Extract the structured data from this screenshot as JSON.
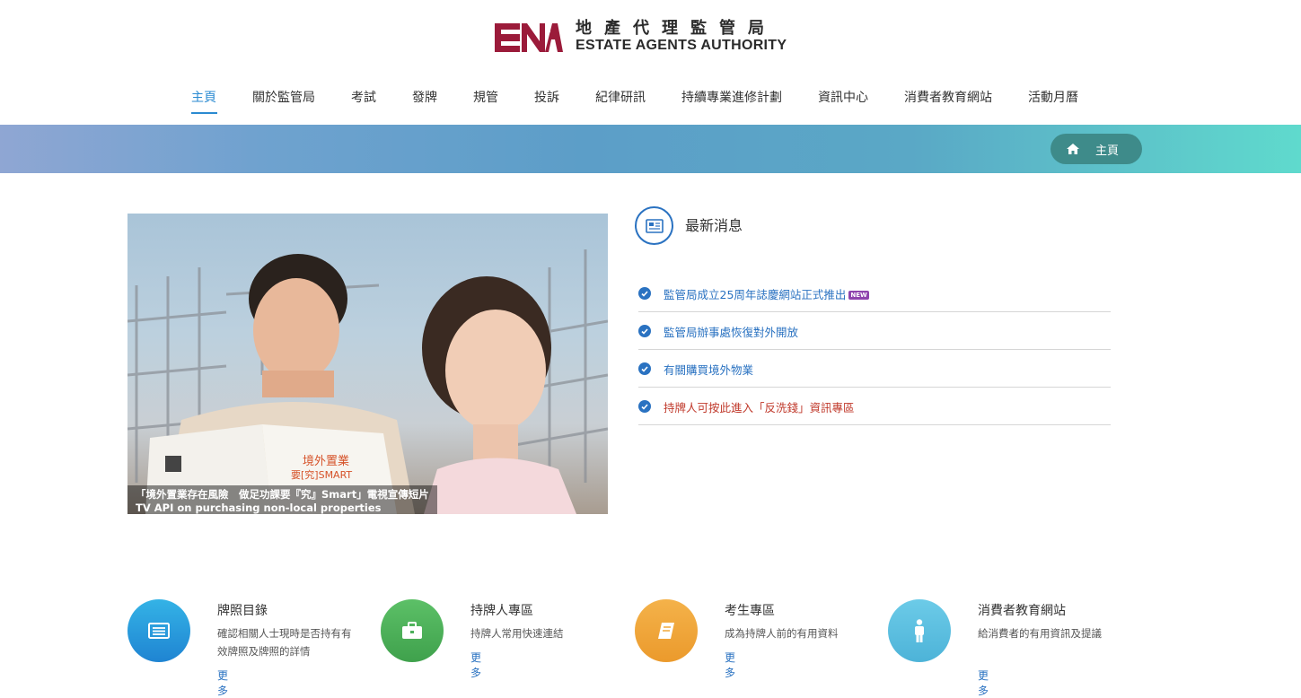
{
  "header": {
    "logo_cn": "地產代理監管局",
    "logo_en": "ESTATE AGENTS AUTHORITY",
    "brand_color": "#9b1b3a"
  },
  "nav": {
    "items": [
      {
        "label": "主頁",
        "active": true
      },
      {
        "label": "關於監管局"
      },
      {
        "label": "考試"
      },
      {
        "label": "發牌"
      },
      {
        "label": "規管"
      },
      {
        "label": "投訴"
      },
      {
        "label": "紀律研訊"
      },
      {
        "label": "持續專業進修計劃"
      },
      {
        "label": "資訊中心"
      },
      {
        "label": "消費者教育網站"
      },
      {
        "label": "活動月曆"
      }
    ]
  },
  "breadcrumb": {
    "icon": "home-icon",
    "label": "主頁"
  },
  "hero": {
    "caption_line1": "「境外置業存在風險　做足功課要『究』Smart」電視宣傳短片",
    "caption_line2": "TV API on purchasing non-local properties",
    "booklet_title": "境外置業",
    "booklet_subtitle": "要[究]SMART"
  },
  "news": {
    "title": "最新消息",
    "icon": "newspaper-icon",
    "items": [
      {
        "text": "監管局成立25周年誌慶網站正式推出",
        "badge": "NEW",
        "color": "#2a72c1"
      },
      {
        "text": "監管局辦事處恢復對外開放",
        "color": "#2a72c1"
      },
      {
        "text": "有關購買境外物業",
        "color": "#2a72c1"
      },
      {
        "text": "持牌人可按此進入「反洗錢」資訊專區",
        "color": "#c0392b"
      }
    ]
  },
  "tiles": [
    {
      "title": "牌照目錄",
      "desc": "確認相關人士現時是否持有有效牌照及牌照的詳情",
      "more": "更多",
      "icon": "list-icon",
      "color": "#2596d8"
    },
    {
      "title": "持牌人專區",
      "desc": "持牌人常用快速連結",
      "more": "更多",
      "icon": "briefcase-icon",
      "color": "#4cb05a"
    },
    {
      "title": "考生專區",
      "desc": "成為持牌人前的有用資料",
      "more": "更多",
      "icon": "book-icon",
      "color": "#f0a93b"
    },
    {
      "title": "消費者教育網站",
      "desc": "給消費者的有用資訊及提議",
      "more": "更多",
      "icon": "person-icon",
      "color": "#5bbfe0"
    }
  ]
}
